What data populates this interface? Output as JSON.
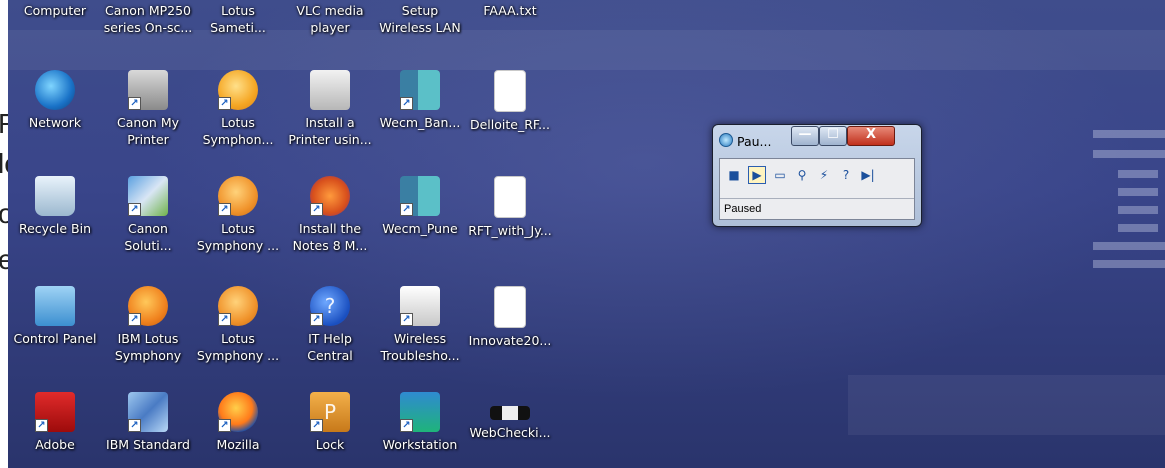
{
  "doc_edge_letters": [
    "R",
    "le",
    "o",
    "e"
  ],
  "desktop": {
    "top_row_labels": [
      "Computer",
      "Canon MP250\nseries On-sc...",
      "Lotus\nSameti...",
      "VLC media\nplayer",
      "Setup\nWireless LAN",
      "FAAA.txt"
    ],
    "icons": [
      {
        "label": "Network",
        "icon": "network-icon",
        "shortcut": false
      },
      {
        "label": "Canon My\nPrinter",
        "icon": "printer-icon",
        "shortcut": true
      },
      {
        "label": "Lotus\nSymphon...",
        "icon": "lotus-symphony-icon",
        "shortcut": true
      },
      {
        "label": "Install a\nPrinter usin...",
        "icon": "install-printer-icon",
        "shortcut": false
      },
      {
        "label": "Wecm_Ban...",
        "icon": "wecm-icon",
        "shortcut": true
      },
      {
        "label": "Delloite_RF...",
        "icon": "file-icon",
        "shortcut": false
      },
      {
        "label": "Recycle Bin",
        "icon": "recycle-bin-icon",
        "shortcut": false
      },
      {
        "label": "Canon\nSoluti...",
        "icon": "canon-solution-icon",
        "shortcut": true
      },
      {
        "label": "Lotus\nSymphony ...",
        "icon": "lotus-presentation-icon",
        "shortcut": true
      },
      {
        "label": "Install the\nNotes 8 M...",
        "icon": "notes-install-icon",
        "shortcut": true
      },
      {
        "label": "Wecm_Pune",
        "icon": "wecm-icon",
        "shortcut": true
      },
      {
        "label": "RFT_with_Jy...",
        "icon": "file-icon",
        "shortcut": false
      },
      {
        "label": "Control Panel",
        "icon": "control-panel-icon",
        "shortcut": false
      },
      {
        "label": "IBM Lotus\nSymphony",
        "icon": "ibm-lotus-symphony-icon",
        "shortcut": true
      },
      {
        "label": "Lotus\nSymphony ...",
        "icon": "lotus-spreadsheet-icon",
        "shortcut": true
      },
      {
        "label": "IT Help\nCentral",
        "icon": "help-icon",
        "shortcut": true
      },
      {
        "label": "Wireless\nTroublesho...",
        "icon": "wireless-icon",
        "shortcut": true
      },
      {
        "label": "Innovate20...",
        "icon": "file-icon",
        "shortcut": false
      },
      {
        "label": "Adobe",
        "icon": "adobe-icon",
        "shortcut": true
      },
      {
        "label": "IBM Standard",
        "icon": "ibm-standard-icon",
        "shortcut": true
      },
      {
        "label": "Mozilla",
        "icon": "firefox-icon",
        "shortcut": true
      },
      {
        "label": "Lock",
        "icon": "lock-icon",
        "shortcut": true
      },
      {
        "label": "Workstation",
        "icon": "workstation-icon",
        "shortcut": true
      },
      {
        "label": "WebChecki...",
        "icon": "webcheck-icon",
        "shortcut": false
      }
    ]
  },
  "paused_window": {
    "title": "Pau...",
    "minimize_label": "—",
    "maximize_label": "☐",
    "close_label": "X",
    "toolbar": [
      "stop-icon",
      "play-icon",
      "screen-icon",
      "find-icon",
      "lightning-icon",
      "help-icon",
      "step-icon"
    ],
    "toolbar_glyphs": [
      "■",
      "▶",
      "▭",
      "⚲",
      "⚡",
      "?",
      "▶|"
    ],
    "status": "Paused"
  }
}
